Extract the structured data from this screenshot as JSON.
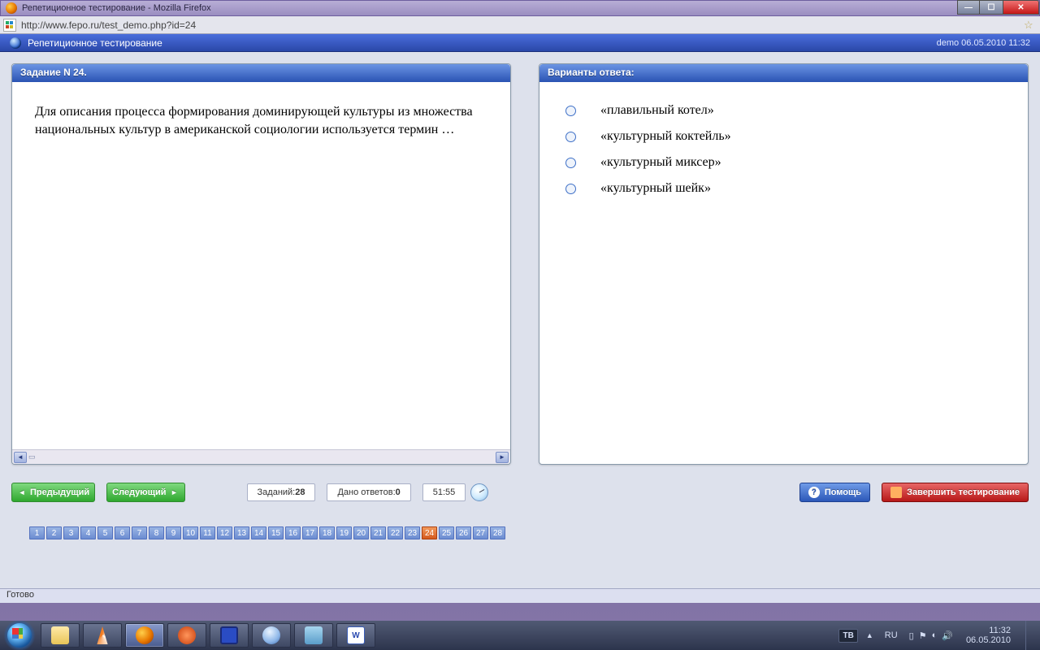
{
  "window": {
    "title": "Репетиционное тестирование - Mozilla Firefox"
  },
  "address": {
    "url": "http://www.fepo.ru/test_demo.php?id=24"
  },
  "header": {
    "title": "Репетиционное тестирование",
    "session": "demo 06.05.2010 11:32"
  },
  "question": {
    "panel_title": "Задание N 24.",
    "text": "Для описания процесса формирования доминирующей культуры из множества национальных культур в американской социологии используется термин …"
  },
  "answers": {
    "panel_title": "Варианты ответа:",
    "options": [
      "«плавильный котел»",
      "«культурный коктейль»",
      "«культурный миксер»",
      "«культурный шейк»"
    ]
  },
  "controls": {
    "prev": "Предыдущий",
    "next": "Следующий",
    "tasks_label": "Заданий: ",
    "tasks_total": "28",
    "answered_label": "Дано ответов:",
    "answered_count": "0",
    "timer": "51:55",
    "help": "Помощь",
    "finish": "Завершить тестирование"
  },
  "pager": {
    "total": 28,
    "current": 24
  },
  "status": {
    "text": "Готово"
  },
  "taskbar": {
    "lang": "RU",
    "tv": "ТВ",
    "time": "11:32",
    "date": "06.05.2010"
  }
}
